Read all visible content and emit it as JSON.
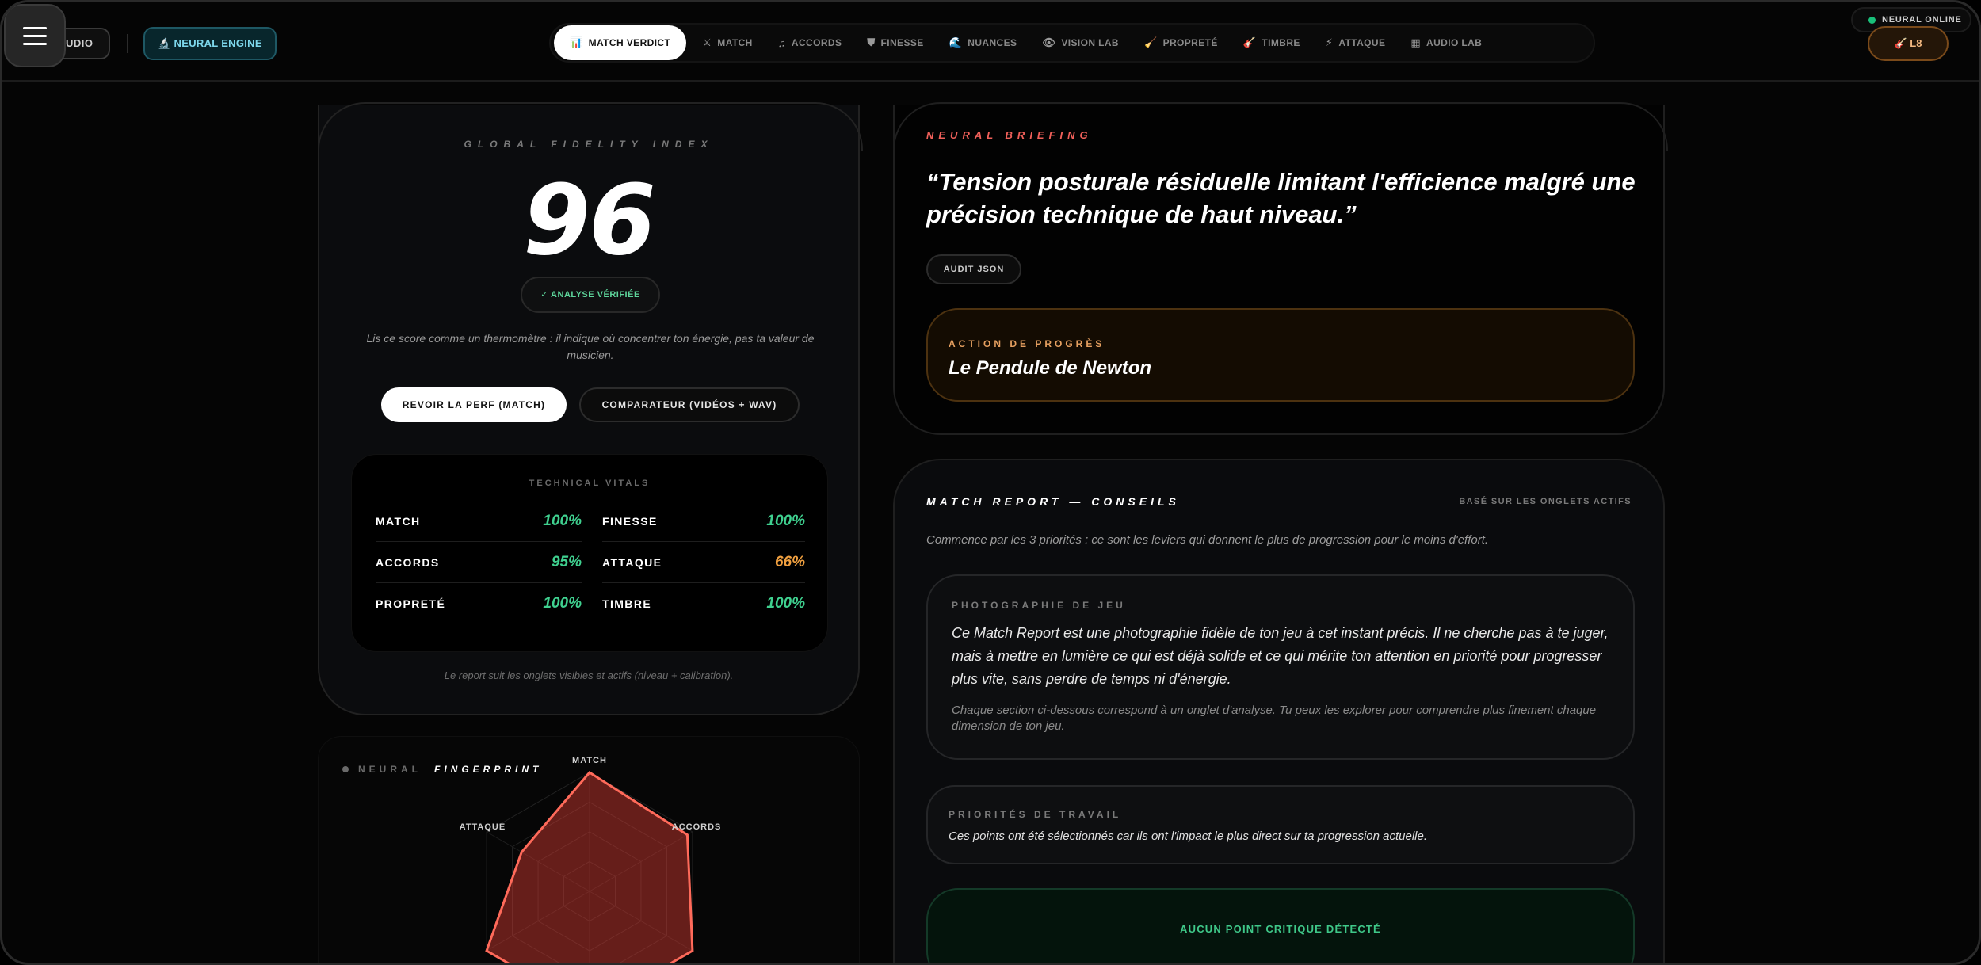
{
  "header": {
    "studio_label": "UDIO",
    "engine_label": "🔬 NEURAL ENGINE",
    "tabs": [
      {
        "icon": "📊",
        "label": "MATCH VERDICT",
        "active": true
      },
      {
        "icon": "⚔",
        "label": "MATCH"
      },
      {
        "icon": "♫",
        "label": "ACCORDS"
      },
      {
        "icon": "⛊",
        "label": "FINESSE"
      },
      {
        "icon": "🌊",
        "label": "NUANCES"
      },
      {
        "icon": "👁",
        "label": "VISION LAB"
      },
      {
        "icon": "🧹",
        "label": "PROPRETÉ"
      },
      {
        "icon": "🎸",
        "label": "TIMBRE"
      },
      {
        "icon": "⚡",
        "label": "ATTAQUE"
      },
      {
        "icon": "▦",
        "label": "AUDIO LAB"
      }
    ],
    "status_label": "NEURAL ONLINE",
    "level_label": "🎸 L8"
  },
  "score_card": {
    "title": "GLOBAL FIDELITY INDEX",
    "score": "96",
    "verified_label": "✓ ANALYSE VÉRIFIÉE",
    "description": "Lis ce score comme un thermomètre : il indique où concentrer ton énergie, pas ta valeur de musicien.",
    "replay_button": "REVOIR LA PERF (MATCH)",
    "compare_button": "COMPARATEUR (VIDÉOS + WAV)",
    "vitals_title": "TECHNICAL VITALS",
    "vitals": [
      {
        "name": "MATCH",
        "value": "100%",
        "color": "#3fd08f"
      },
      {
        "name": "FINESSE",
        "value": "100%",
        "color": "#3fd08f"
      },
      {
        "name": "ACCORDS",
        "value": "95%",
        "color": "#3fd08f"
      },
      {
        "name": "ATTAQUE",
        "value": "66%",
        "color": "#f0a040"
      },
      {
        "name": "PROPRETÉ",
        "value": "100%",
        "color": "#3fd08f"
      },
      {
        "name": "TIMBRE",
        "value": "100%",
        "color": "#3fd08f"
      }
    ],
    "footnote": "Le report suit les onglets visibles et actifs (niveau + calibration)."
  },
  "fingerprint": {
    "title_a": "NEURAL",
    "title_b": "FINGERPRINT",
    "axes": [
      "MATCH",
      "ACCORDS",
      "ATTAQUE"
    ],
    "values": {
      "MATCH": 100,
      "ACCORDS": 95,
      "ATTAQUE": 66
    }
  },
  "briefing": {
    "label": "NEURAL BRIEFING",
    "quote": "“Tension posturale résiduelle limitant l'efficience malgré une précision technique de haut niveau.”",
    "audit_button": "AUDIT JSON",
    "action_label": "ACTION DE PROGRÈS",
    "action_title": "Le Pendule de Newton"
  },
  "match_report": {
    "title": "MATCH REPORT — CONSEILS",
    "subtitle": "BASÉ SUR LES ONGLETS ACTIFS",
    "intro": "Commence par les 3 priorités : ce sont les leviers qui donnent le plus de progression pour le moins d'effort.",
    "photo_title": "PHOTOGRAPHIE DE JEU",
    "photo_text": "Ce Match Report est une photographie fidèle de ton jeu à cet instant précis. Il ne cherche pas à te juger, mais à mettre en lumière ce qui est déjà solide et ce qui mérite ton attention en priorité pour progresser plus vite, sans perdre de temps ni d'énergie.",
    "photo_note": "Chaque section ci-dessous correspond à un onglet d'analyse. Tu peux les explorer pour comprendre plus finement chaque dimension de ton jeu.",
    "priorities_title": "PRIORITÉS DE TRAVAIL",
    "priorities_text": "Ces points ont été sélectionnés car ils ont l'impact le plus direct sur ta progression actuelle.",
    "critical_label": "AUCUN POINT CRITIQUE DÉTECTÉ"
  }
}
